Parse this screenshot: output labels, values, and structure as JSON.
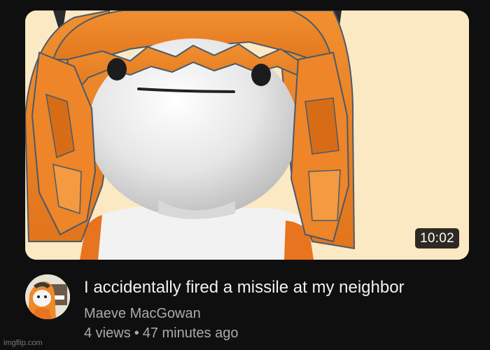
{
  "video": {
    "duration": "10:02",
    "title": "I accidentally fired a missile at my neighbor",
    "channel": "Maeve MacGowan",
    "views": "4 views",
    "separator": "•",
    "age": "47 minutes ago"
  },
  "watermark": "imgflip.com",
  "colors": {
    "background": "#0f0f0f",
    "thumbnail_bg": "#fbe9c4",
    "hair_orange": "#ef8a2a",
    "title_text": "#f1f1f1",
    "secondary_text": "#aaaaaa"
  }
}
